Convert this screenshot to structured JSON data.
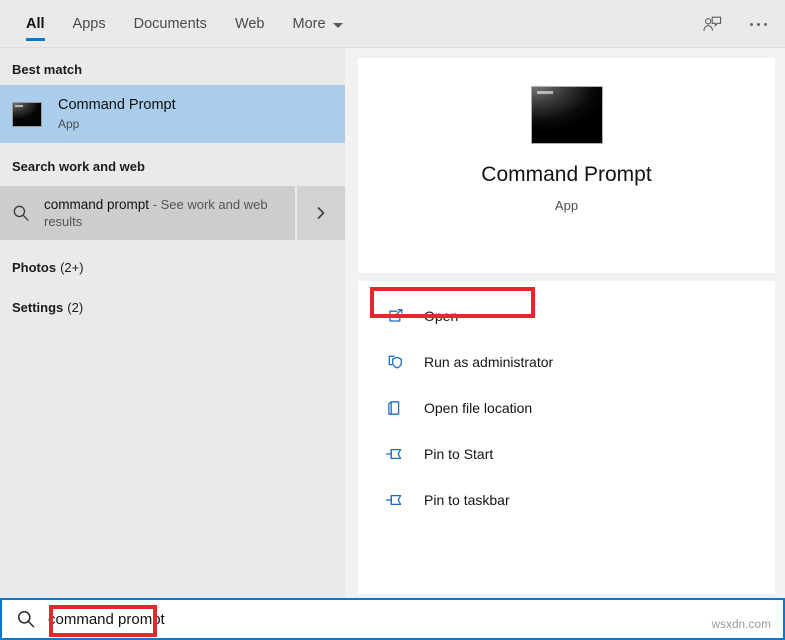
{
  "header": {
    "tabs": [
      {
        "label": "All",
        "active": true
      },
      {
        "label": "Apps",
        "active": false
      },
      {
        "label": "Documents",
        "active": false
      },
      {
        "label": "Web",
        "active": false
      },
      {
        "label": "More",
        "active": false,
        "has_caret": true
      }
    ],
    "feedback_icon": "person-feedback-icon",
    "overflow_icon": "ellipsis-icon"
  },
  "left": {
    "best_match_label": "Best match",
    "best_match": {
      "title": "Command Prompt",
      "subtitle": "App",
      "icon": "command-prompt-icon",
      "selected": true
    },
    "search_web_label": "Search work and web",
    "web_result": {
      "query": "command prompt",
      "suffix": "- See work and web results",
      "icon": "search-icon",
      "chevron": "chevron-right-icon"
    },
    "categories": [
      {
        "name": "Photos",
        "count": "(2+)"
      },
      {
        "name": "Settings",
        "count": "(2)"
      }
    ]
  },
  "preview": {
    "icon": "command-prompt-icon",
    "title": "Command Prompt",
    "subtitle": "App",
    "actions": [
      {
        "label": "Open",
        "icon": "open-external-icon"
      },
      {
        "label": "Run as administrator",
        "icon": "shield-icon",
        "highlighted": true
      },
      {
        "label": "Open file location",
        "icon": "folder-open-icon"
      },
      {
        "label": "Pin to Start",
        "icon": "pin-icon"
      },
      {
        "label": "Pin to taskbar",
        "icon": "pin-icon"
      }
    ]
  },
  "searchbar": {
    "icon": "search-icon",
    "value": "command prompt",
    "placeholder": "Type here to search"
  },
  "watermark": "wsxdn.com",
  "colors": {
    "accent_blue": "#0b78d0",
    "selection_blue": "#a9cdeb",
    "annotation_red": "#e8262b",
    "icon_blue": "#1b6ec2",
    "panel_bg": "#eaeaea",
    "preview_bg": "#f2f2f2"
  }
}
